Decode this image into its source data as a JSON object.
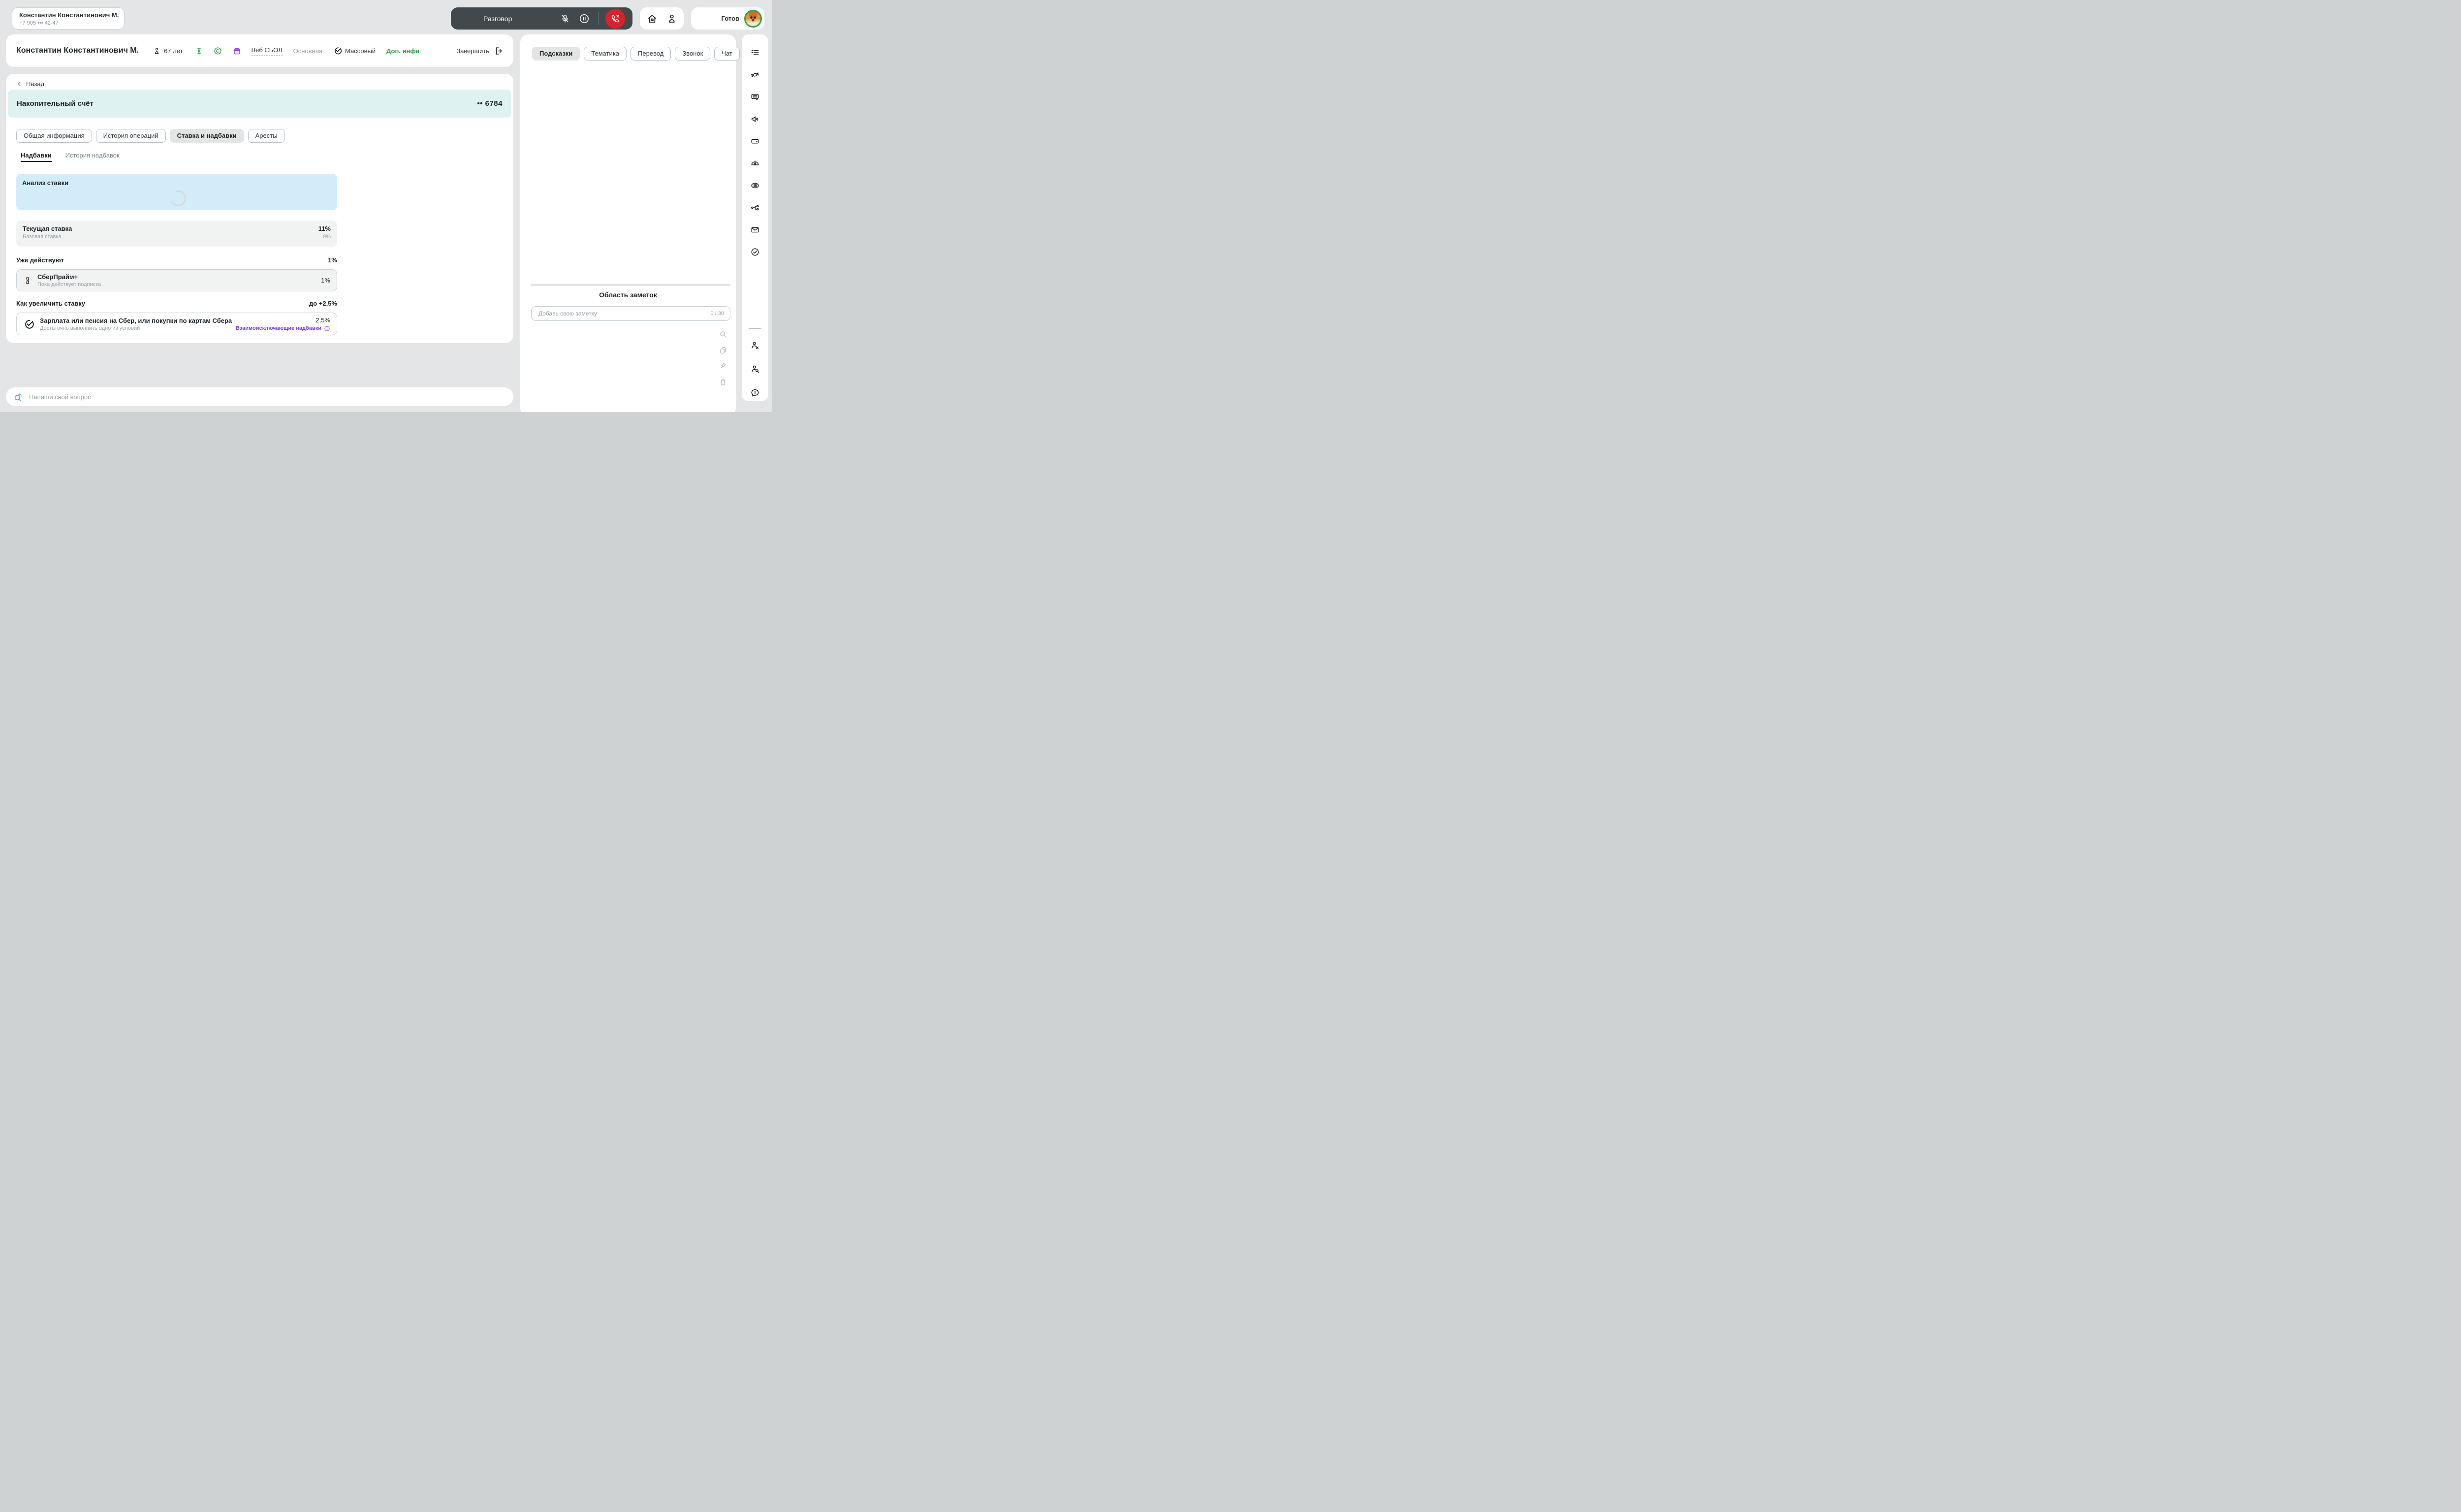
{
  "top_bar": {
    "client_chip": {
      "name": "Константин Константинович М.",
      "phone": "+7 905 ••• 42-47"
    },
    "call": {
      "label": "Разговор"
    },
    "status": {
      "label": "Готов"
    }
  },
  "header": {
    "name": "Константин Константинович М.",
    "age": "67 лет",
    "channel": "Веб СБОЛ",
    "line_type": "Основная",
    "segment": "Массовый",
    "extra_info": "Доп. инфа",
    "finish": "Завершить"
  },
  "account": {
    "back": "Назад",
    "title": "Накопительный счёт",
    "number_masked": "•• 6784",
    "tabs": [
      {
        "label": "Общая информация",
        "active": false
      },
      {
        "label": "История операций",
        "active": false
      },
      {
        "label": "Ставка и надбавки",
        "active": true
      },
      {
        "label": "Аресты",
        "active": false
      }
    ],
    "subtabs": [
      {
        "label": "Надбавки",
        "active": true
      },
      {
        "label": "История надбавок",
        "active": false
      }
    ],
    "analysis": {
      "title": "Анализ ставки"
    },
    "rate": {
      "label": "Текущая ставка",
      "value": "11%",
      "sub_label": "Базовая ставка",
      "sub_value": "9%"
    },
    "active_section": {
      "title": "Уже действуют",
      "total": "1%",
      "item": {
        "title": "СберПрайм+",
        "subtitle": "Пока действует подписка",
        "value": "1%"
      }
    },
    "increase_section": {
      "title": "Как увеличить ставку",
      "total": "до +2,5%",
      "item": {
        "title": "Зарплата или пенсия на Сбер, или покупки по картам Сбера",
        "subtitle": "Достаточно выполнить одно из условий",
        "value": "2,5%",
        "link": "Взаимоисключающие надбавки"
      }
    }
  },
  "question_bar": {
    "placeholder": "Напиши свой вопрос"
  },
  "right_panel": {
    "tabs": [
      {
        "label": "Подсказки",
        "active": true
      },
      {
        "label": "Тематика",
        "active": false
      },
      {
        "label": "Перевод",
        "active": false
      },
      {
        "label": "Звонок",
        "active": false
      },
      {
        "label": "Чат",
        "active": false
      }
    ],
    "notes": {
      "title": "Область заметок",
      "placeholder": "Добавь свою заметку",
      "counter": "0 / 30"
    },
    "note_tools": [
      "search-icon",
      "copy-icon",
      "pin-icon",
      "trash-icon"
    ]
  },
  "sidebar_icons": [
    "list-icon",
    "candy-icon",
    "chat-script-icon",
    "speaker-icon",
    "wallet-icon",
    "gauge-icon",
    "summary-icon",
    "network-icon",
    "mail-icon",
    "task-check-icon",
    "person-x-icon",
    "person-search-icon",
    "chat-alert-icon"
  ],
  "colors": {
    "background": "#E3E5E6",
    "accent_green": "#21A038",
    "hangup_red": "#D8232A",
    "call_pill_dark": "#42494C",
    "link_purple": "#7A3FE4",
    "ai_blue": "#35B1E8",
    "account_band_teal": "#DEF2F1",
    "analysis_blue": "#D2ECF9",
    "card_gray": "#F1F2F2"
  }
}
